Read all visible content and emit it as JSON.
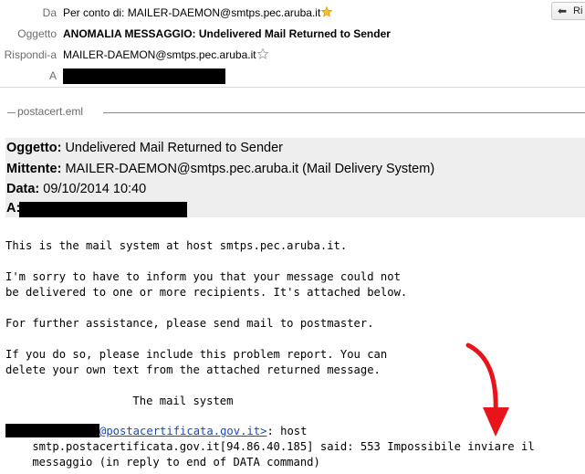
{
  "header": {
    "from": {
      "label": "Da",
      "value": "Per conto di: MAILER-DAEMON@smtps.pec.aruba.it"
    },
    "subject": {
      "label": "Oggetto",
      "value": "ANOMALIA MESSAGGIO: Undelivered Mail Returned to Sender"
    },
    "reply_to": {
      "label": "Rispondi-a",
      "value": "MAILER-DAEMON@smtps.pec.aruba.it"
    },
    "to": {
      "label": "A"
    },
    "reply_button_label": "Ri"
  },
  "attachment": {
    "name": "postacert.eml"
  },
  "message_header": {
    "subject": {
      "label": "Oggetto:",
      "value": "Undelivered Mail Returned to Sender"
    },
    "sender": {
      "label": "Mittente:",
      "value": "MAILER-DAEMON@smtps.pec.aruba.it (Mail Delivery System)"
    },
    "date": {
      "label": "Data:",
      "value": "09/10/2014 10:40"
    },
    "to": {
      "label": "A:"
    }
  },
  "body": {
    "line1": "This is the mail system at host smtps.pec.aruba.it.",
    "line2": "I'm sorry to have to inform you that your message could not",
    "line3": "be delivered to one or more recipients. It's attached below.",
    "line4": "For further assistance, please send mail to postmaster.",
    "line5": "If you do so, please include this problem report. You can",
    "line6": "delete your own text from the attached returned message.",
    "signature": "                   The mail system",
    "recipient_link": "@postacertificata.gov.it>",
    "recipient_suffix": ": host",
    "error_line1": "    smtp.postacertificata.gov.it[94.86.40.185] said: 553 Impossibile inviare il",
    "error_line2": "    messaggio (in reply to end of DATA command)"
  },
  "colors": {
    "annotation_arrow": "#e8141b",
    "link": "#1a49b8",
    "table_bg": "#eeeeee"
  }
}
